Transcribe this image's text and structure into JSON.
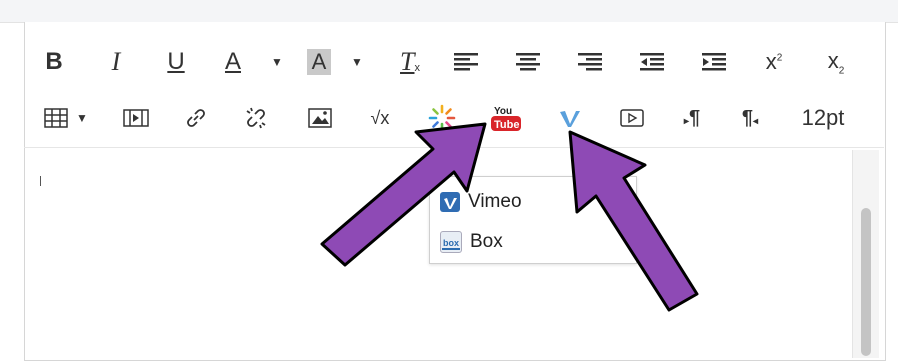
{
  "toolbar": {
    "row1": [
      {
        "name": "bold-button",
        "label": "B"
      },
      {
        "name": "italic-button",
        "label": "I"
      },
      {
        "name": "underline-button",
        "label": "U"
      },
      {
        "name": "text-color-button",
        "label": "A"
      },
      {
        "name": "highlight-color-button",
        "label": "A"
      },
      {
        "name": "clear-format-button",
        "label": "T"
      }
    ],
    "font_size": "12pt"
  },
  "media_menu": {
    "items": [
      {
        "label": "Vimeo",
        "icon": "vimeo-icon"
      },
      {
        "label": "Box",
        "icon": "box-icon"
      }
    ]
  },
  "colors": {
    "arrow_fill": "#8e4ab5",
    "arrow_stroke": "#000000",
    "youtube_red": "#d9252a",
    "vimeo_blue": "#2f6cb3",
    "accent": "#2266aa"
  }
}
